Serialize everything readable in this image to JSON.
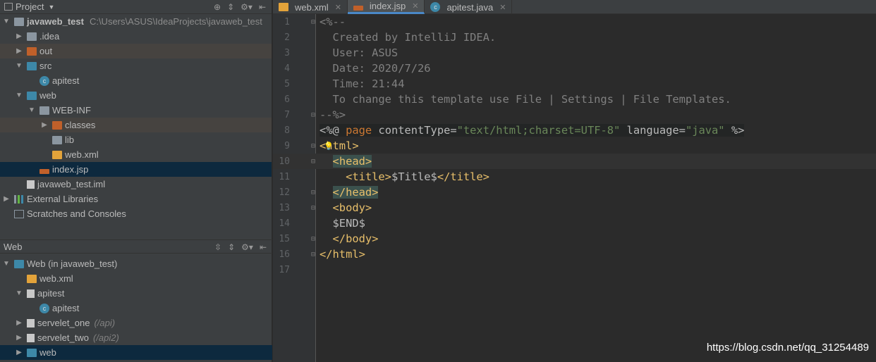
{
  "project_panel": {
    "title": "Project",
    "dropdown_icon": "chevron-down-icon",
    "tree": [
      {
        "label": "javaweb_test",
        "path": "C:\\Users\\ASUS\\IdeaProjects\\javaweb_test",
        "depth": 0,
        "arrow": "down",
        "icon": "module",
        "bold": true
      },
      {
        "label": ".idea",
        "depth": 1,
        "arrow": "right",
        "icon": "folder-gray"
      },
      {
        "label": "out",
        "depth": 1,
        "arrow": "right",
        "icon": "folder-orange",
        "hl": true
      },
      {
        "label": "src",
        "depth": 1,
        "arrow": "down",
        "icon": "folder-blue"
      },
      {
        "label": "apitest",
        "depth": 2,
        "arrow": "",
        "icon": "class"
      },
      {
        "label": "web",
        "depth": 1,
        "arrow": "down",
        "icon": "folder-blue"
      },
      {
        "label": "WEB-INF",
        "depth": 2,
        "arrow": "down",
        "icon": "folder-gray"
      },
      {
        "label": "classes",
        "depth": 3,
        "arrow": "right",
        "icon": "folder-orange",
        "hl": true
      },
      {
        "label": "lib",
        "depth": 3,
        "arrow": "",
        "icon": "folder-gray"
      },
      {
        "label": "web.xml",
        "depth": 3,
        "arrow": "",
        "icon": "xml"
      },
      {
        "label": "index.jsp",
        "depth": 2,
        "arrow": "",
        "icon": "jsp",
        "sel": true
      },
      {
        "label": "javaweb_test.iml",
        "depth": 1,
        "arrow": "",
        "icon": "file"
      },
      {
        "label": "External Libraries",
        "depth": 0,
        "arrow": "right",
        "icon": "libraries"
      },
      {
        "label": "Scratches and Consoles",
        "depth": 0,
        "arrow": "",
        "icon": "scratches"
      }
    ]
  },
  "web_panel": {
    "title": "Web",
    "tree": [
      {
        "label": "Web (in javaweb_test)",
        "depth": 0,
        "arrow": "down",
        "icon": "web-facet"
      },
      {
        "label": "web.xml",
        "depth": 1,
        "arrow": "",
        "icon": "xml"
      },
      {
        "label": "apitest",
        "depth": 1,
        "arrow": "down",
        "icon": "servlet"
      },
      {
        "label": "apitest",
        "depth": 2,
        "arrow": "",
        "icon": "class"
      },
      {
        "label": "servelet_one",
        "suffix": "(/api)",
        "depth": 1,
        "arrow": "right",
        "icon": "servlet"
      },
      {
        "label": "servelet_two",
        "suffix": "(/api2)",
        "depth": 1,
        "arrow": "right",
        "icon": "servlet"
      },
      {
        "label": "web",
        "depth": 1,
        "arrow": "right",
        "icon": "folder-blue",
        "sel": true
      }
    ]
  },
  "tabs": [
    {
      "label": "web.xml",
      "icon": "xml"
    },
    {
      "label": "index.jsp",
      "icon": "jsp",
      "active": true
    },
    {
      "label": "apitest.java",
      "icon": "class"
    }
  ],
  "editor": {
    "lines": [
      [
        [
          "<%--",
          "cmt"
        ]
      ],
      [
        [
          "  Created by IntelliJ IDEA.",
          "cmt"
        ]
      ],
      [
        [
          "  User: ASUS",
          "cmt"
        ]
      ],
      [
        [
          "  Date: 2020/7/26",
          "cmt"
        ]
      ],
      [
        [
          "  Time: 21:44",
          "cmt"
        ]
      ],
      [
        [
          "  To change this template use File | Settings | File Templates.",
          "cmt"
        ]
      ],
      [
        [
          "--%>",
          "cmt"
        ]
      ],
      [
        [
          "<%@ ",
          "attr"
        ],
        [
          "page",
          "kw"
        ],
        [
          " contentType=",
          "attr"
        ],
        [
          "\"text/html;charset=UTF-8\"",
          "str"
        ],
        [
          " language=",
          "attr"
        ],
        [
          "\"java\"",
          "str"
        ],
        [
          " %>",
          "attr"
        ]
      ],
      [
        [
          "<html>",
          "tag"
        ]
      ],
      [
        [
          "  ",
          "attr"
        ],
        [
          "<head>",
          "tag mark"
        ]
      ],
      [
        [
          "    <title>",
          "tag"
        ],
        [
          "$Title$",
          "attr"
        ],
        [
          "</title>",
          "tag"
        ]
      ],
      [
        [
          "  ",
          "attr"
        ],
        [
          "</head>",
          "tag mark"
        ]
      ],
      [
        [
          "  <body>",
          "tag"
        ]
      ],
      [
        [
          "  $END$",
          "attr"
        ]
      ],
      [
        [
          "  </body>",
          "tag"
        ]
      ],
      [
        [
          "</html>",
          "tag"
        ]
      ],
      []
    ]
  },
  "watermark": "https://blog.csdn.net/qq_31254489"
}
